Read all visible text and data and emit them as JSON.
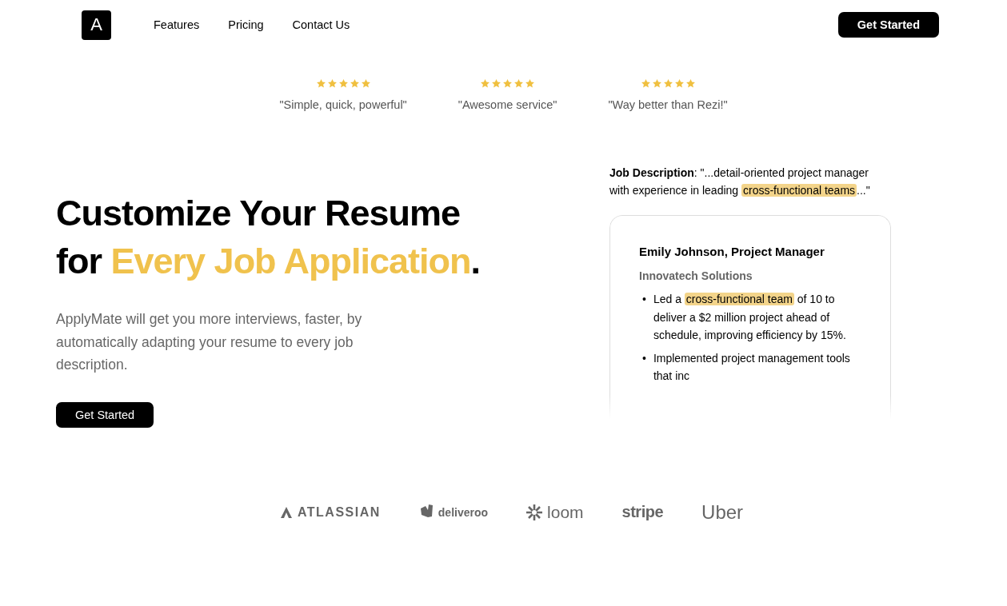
{
  "nav": {
    "logo": "A",
    "links": [
      "Features",
      "Pricing",
      "Contact Us"
    ],
    "cta": "Get Started"
  },
  "reviews": [
    {
      "stars": 5,
      "quote": "\"Simple, quick, powerful\""
    },
    {
      "stars": 5,
      "quote": "\"Awesome service\""
    },
    {
      "stars": 5,
      "quote": "\"Way better than Rezi!\""
    }
  ],
  "hero": {
    "headline": [
      {
        "text": "Customize Your Resume for ",
        "accent": false
      },
      {
        "text": "Every Job Application",
        "accent": true
      },
      {
        "text": ".",
        "accent": false
      }
    ],
    "description": "ApplyMate will get you more interviews, faster, by automatically adapting your resume to every job description.",
    "cta": "Get Started"
  },
  "job_description": [
    {
      "text": "**Job Description**: \"...detail-oriented project manager with experience in leading ",
      "highlighted": false
    },
    {
      "text": "cross-functional teams",
      "highlighted": true
    },
    {
      "text": "...\"",
      "highlighted": false
    }
  ],
  "resume": {
    "bullet_marker": "•",
    "name": "Emily Johnson, Project Manager",
    "company": "Innovatech Solutions",
    "bullets": [
      [
        {
          "text": "Led a ",
          "highlighted": false
        },
        {
          "text": "cross-functional team",
          "highlighted": true
        },
        {
          "text": " of 10 to deliver a $2 million project ahead of schedule, improving efficiency by 15%.",
          "highlighted": false
        }
      ],
      [
        {
          "text": "Implemented project management tools that inc",
          "highlighted": false
        }
      ]
    ]
  },
  "logos": [
    {
      "kind": "atlassian",
      "text": "ATLASSIAN"
    },
    {
      "kind": "deliveroo",
      "text": "deliveroo"
    },
    {
      "kind": "loom",
      "text": "loom"
    },
    {
      "kind": "stripe",
      "text": "stripe"
    },
    {
      "kind": "uber",
      "text": "Uber"
    }
  ]
}
